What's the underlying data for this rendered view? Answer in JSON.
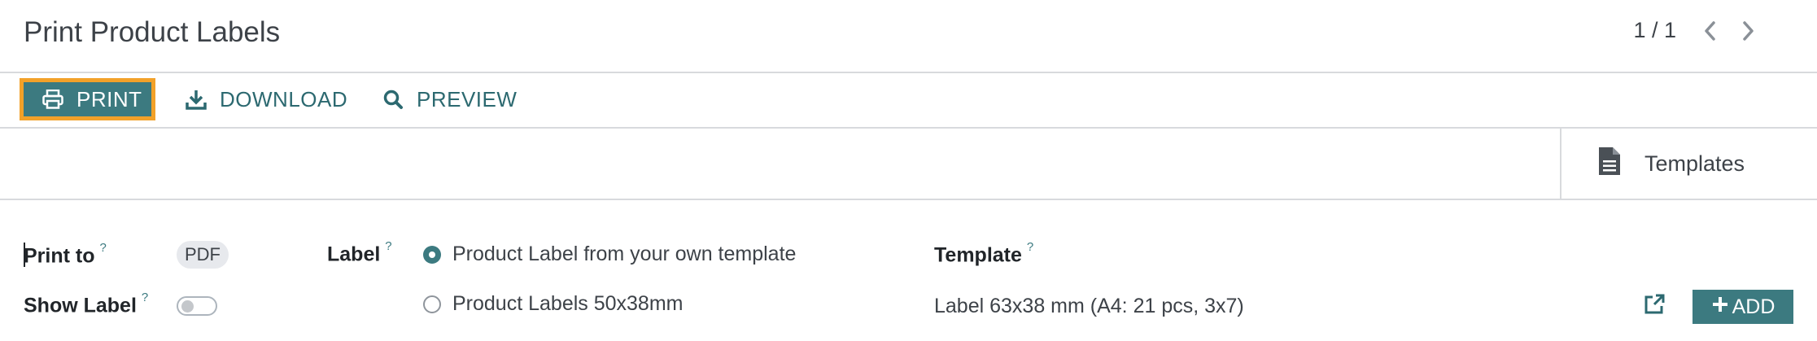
{
  "header": {
    "title": "Print Product Labels",
    "pager": "1 / 1"
  },
  "actions": {
    "print_label": "PRINT",
    "download_label": "DOWNLOAD",
    "preview_label": "PREVIEW"
  },
  "status": {
    "templates_label": "Templates"
  },
  "form": {
    "print_to_label": "Print to",
    "print_to_value": "PDF",
    "show_label_label": "Show Label",
    "label_label": "Label",
    "label_options": [
      "Product Label from your own template",
      "Product Labels 50x38mm"
    ],
    "template_label": "Template",
    "template_value": "Label 63x38 mm (A4: 21 pcs, 3x7)",
    "add_label": "ADD",
    "help_marker": "?"
  },
  "colors": {
    "accent": "#3c7a80",
    "highlight": "#f2a129",
    "border": "#d8dadd"
  }
}
